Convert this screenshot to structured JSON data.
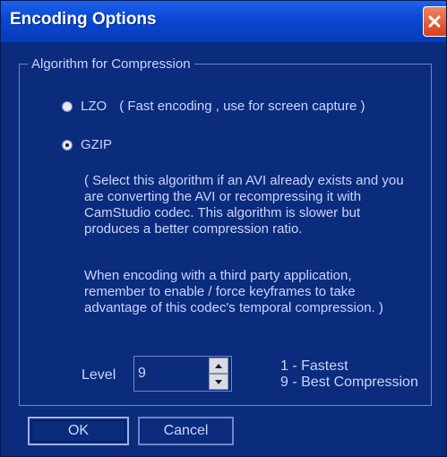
{
  "window": {
    "title": "Encoding Options"
  },
  "group": {
    "label": "Algorithm for Compression"
  },
  "options": [
    {
      "label": "LZO",
      "note": "( Fast encoding , use for screen capture )",
      "checked": false
    },
    {
      "label": "GZIP",
      "checked": true
    }
  ],
  "gzip_description": {
    "line1": "( Select this algorithm if an AVI already exists and you",
    "line2": "are converting the AVI or recompressing it with",
    "line3": "CamStudio codec. This algorithm is slower but",
    "line4": "produces a better compression ratio."
  },
  "third_party_note": {
    "line1": "When encoding with a third party application,",
    "line2": "remember to enable / force keyframes to take",
    "line3": "advantage of this codec's temporal compression. )"
  },
  "level": {
    "label": "Level",
    "value": "9",
    "legend_fast": "1 - Fastest",
    "legend_best": "9 - Best Compression"
  },
  "buttons": {
    "ok": "OK",
    "cancel": "Cancel"
  },
  "colors": {
    "titlebar": "#0a49d6",
    "client": "#0b2b7c",
    "text": "#c9d6ff",
    "close": "#d6411b"
  },
  "icons": {
    "close": "close-icon",
    "spin_up": "up-arrow-icon",
    "spin_down": "down-arrow-icon"
  }
}
